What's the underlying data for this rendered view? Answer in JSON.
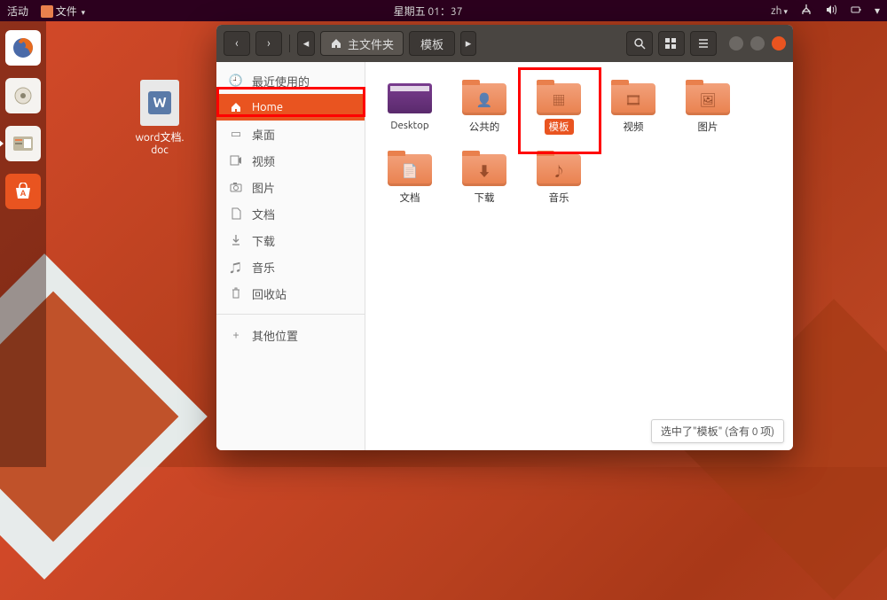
{
  "topbar": {
    "activities": "活动",
    "app_name": "文件",
    "datetime": "星期五 01：37",
    "input_method": "zh"
  },
  "desktop": {
    "word_doc": "word文档.\ndoc"
  },
  "fm": {
    "path_main": "主文件夹",
    "path_sub": "模板"
  },
  "sidebar": {
    "items": [
      {
        "icon": "clock",
        "label": "最近使用的"
      },
      {
        "icon": "home",
        "label": "Home"
      },
      {
        "icon": "desk",
        "label": "桌面"
      },
      {
        "icon": "video",
        "label": "视频"
      },
      {
        "icon": "photo",
        "label": "图片"
      },
      {
        "icon": "doc",
        "label": "文档"
      },
      {
        "icon": "down",
        "label": "下载"
      },
      {
        "icon": "music",
        "label": "音乐"
      },
      {
        "icon": "trash",
        "label": "回收站"
      }
    ],
    "other": "其他位置"
  },
  "folders": {
    "desktop": "Desktop",
    "public": "公共的",
    "templates": "模板",
    "videos": "视频",
    "pictures": "图片",
    "documents": "文档",
    "downloads": "下载",
    "music": "音乐"
  },
  "status": "选中了\"模板\" (含有 0 项)",
  "highlights": [
    {
      "target": "sidebar-home"
    },
    {
      "target": "folder-templates"
    }
  ]
}
